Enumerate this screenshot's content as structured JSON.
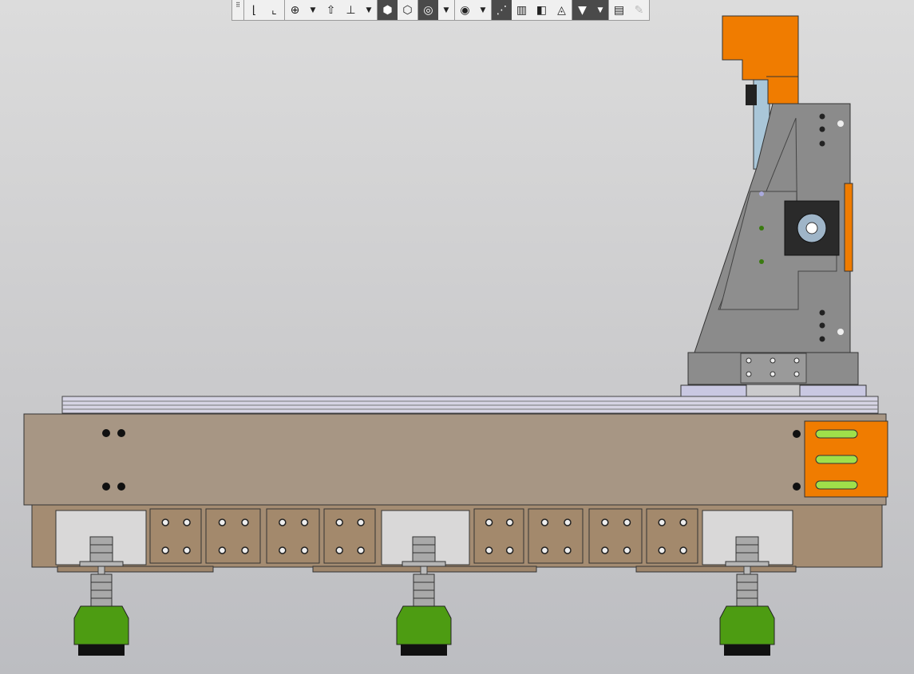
{
  "toolbar": {
    "groups": [
      [
        {
          "icon": "grip-icon",
          "glyph": "⠿",
          "grip": true
        }
      ],
      [
        {
          "icon": "sketch-icon",
          "glyph": "⌊"
        },
        {
          "icon": "parametric-sketch-icon",
          "glyph": "⌞"
        }
      ],
      [
        {
          "icon": "zoom-icon",
          "glyph": "⊕"
        },
        {
          "icon": "chevron-down-icon",
          "glyph": "▼",
          "dd": true
        },
        {
          "icon": "orientation-icon",
          "glyph": "⇧"
        },
        {
          "icon": "axes-icon",
          "glyph": "⊥"
        },
        {
          "icon": "chevron-down-icon",
          "glyph": "▼",
          "dd": true
        }
      ],
      [
        {
          "icon": "shaded-view-icon",
          "glyph": "⬢",
          "dark": true
        },
        {
          "icon": "wireframe-view-icon",
          "glyph": "⬡"
        }
      ],
      [
        {
          "icon": "hide-icon",
          "glyph": "◎",
          "dark": true
        },
        {
          "icon": "chevron-down-icon",
          "glyph": "▼",
          "dd": true
        }
      ],
      [
        {
          "icon": "show-icon",
          "glyph": "◉"
        },
        {
          "icon": "chevron-down-icon",
          "glyph": "▼",
          "dd": true
        }
      ],
      [
        {
          "icon": "constraints-icon",
          "glyph": "⋰",
          "dark": true
        },
        {
          "icon": "section-icon",
          "glyph": "▥"
        },
        {
          "icon": "layers-icon",
          "glyph": "◧"
        },
        {
          "icon": "perspective-icon",
          "glyph": "◬"
        }
      ],
      [
        {
          "icon": "filter-icon",
          "glyph": "▼",
          "dark": true
        },
        {
          "icon": "chevron-down-icon",
          "glyph": "▼",
          "dd": true,
          "dark": true
        }
      ],
      [
        {
          "icon": "measure-icon",
          "glyph": "▤"
        },
        {
          "icon": "eyedropper-icon",
          "glyph": "✎",
          "disabled": true
        }
      ]
    ]
  },
  "colors": {
    "beam": "#a79684",
    "frame": "#a48c72",
    "plate": "#a3896c",
    "orange": "#f07c00",
    "gantry": "#8b8b8b",
    "carriage": "#c9c8e2",
    "foot": "#4d9c12",
    "rail": "#d6d4e4"
  }
}
